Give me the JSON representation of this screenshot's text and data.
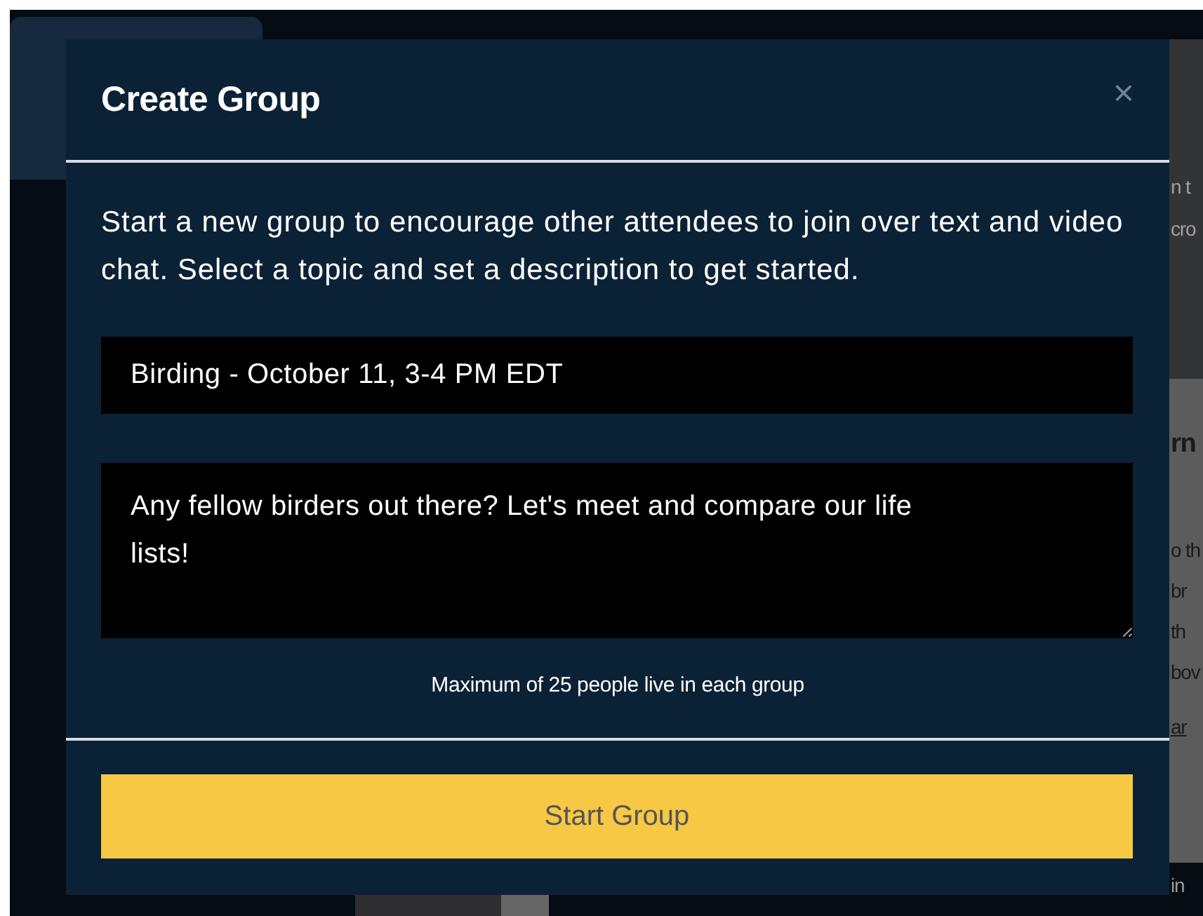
{
  "backdrop": {
    "fragments": [
      {
        "kind": "text",
        "text": "n t"
      },
      {
        "kind": "text",
        "text": "cro"
      },
      {
        "kind": "heading",
        "text": "rn"
      },
      {
        "kind": "text",
        "text": "o th"
      },
      {
        "kind": "text",
        "text": "br"
      },
      {
        "kind": "text",
        "text": "th"
      },
      {
        "kind": "text",
        "text": "bov"
      },
      {
        "kind": "link",
        "text": "ar"
      },
      {
        "kind": "footer",
        "text": "in"
      }
    ]
  },
  "dialog": {
    "title": "Create Group",
    "close_label": "×",
    "description": "Start a new group to encourage other attendees to join over text and video chat. Select a topic and set a description to get started.",
    "topic_field": {
      "value": "Birding - October 11, 3-4 PM EDT"
    },
    "description_field": {
      "value": "Any fellow birders out there? Let's meet and compare our life lists!"
    },
    "note": "Maximum of 25 people live in each group",
    "submit_button": "Start Group"
  }
}
